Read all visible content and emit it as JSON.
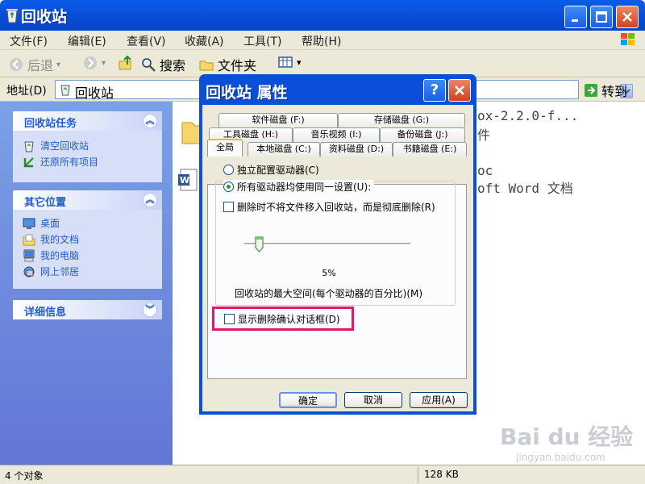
{
  "window": {
    "title": "回收站"
  },
  "menu": [
    "文件(F)",
    "编辑(E)",
    "查看(V)",
    "收藏(A)",
    "工具(T)",
    "帮助(H)"
  ],
  "toolbar": {
    "back": "后退",
    "search": "搜索",
    "folders": "文件夹"
  },
  "address": {
    "label": "地址(D)",
    "value": "回收站",
    "go": "转到"
  },
  "left_panels": {
    "tasks": {
      "title": "回收站任务",
      "items": [
        "清空回收站",
        "还原所有项目"
      ]
    },
    "places": {
      "title": "其它位置",
      "items": [
        "桌面",
        "我的文档",
        "我的电脑",
        "网上邻居"
      ]
    },
    "details": {
      "title": "详细信息"
    }
  },
  "files": [
    {
      "name_fragment": "ox-2.2.0-f...",
      "type_fragment": "件"
    },
    {
      "name_fragment": "oc",
      "type_fragment": "oft Word 文档"
    }
  ],
  "status": {
    "left": "4 个对象",
    "right": "128 KB"
  },
  "dialog": {
    "title": "回收站 属性",
    "help": "?",
    "tabs_row1": [
      "软件磁盘 (F:)",
      "存储磁盘 (G:)"
    ],
    "tabs_row2": [
      "工具磁盘 (H:)",
      "音乐视频 (I:)",
      "备份磁盘 (J:)"
    ],
    "tabs_row3": [
      "全局",
      "本地磁盘 (C:)",
      "资料磁盘 (D:)",
      "书籍磁盘 (E:)"
    ],
    "radio_independent": "独立配置驱动器(C)",
    "radio_same": "所有驱动器均使用同一设置(U):",
    "check_nomove": "删除时不将文件移入回收站，而是彻底删除(R)",
    "slider_percent": "5%",
    "slider_value": 0.05,
    "max_space_label": "回收站的最大空间(每个驱动器的百分比)(M)",
    "check_confirm": "显示删除确认对话框(D)",
    "buttons": {
      "ok": "确定",
      "cancel": "取消",
      "apply": "应用(A)"
    }
  },
  "watermark": {
    "main": "Bai du 经验",
    "sub": "jingyan.baidu.com"
  },
  "colors": {
    "xp_blue": "#0b4ed8",
    "highlight_pink": "#e2166d",
    "link_blue": "#215dc6"
  }
}
